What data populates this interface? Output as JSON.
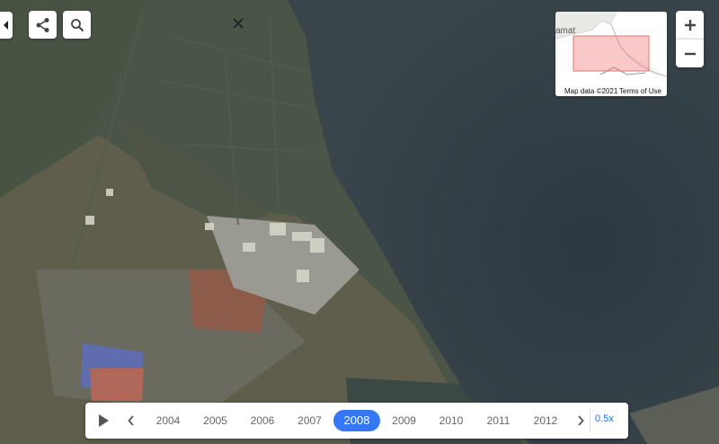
{
  "toolbar": {
    "collapse_icon": "chevron-left-icon",
    "share_icon": "share-icon",
    "search_icon": "search-icon",
    "close_icon": "close-icon"
  },
  "minimap": {
    "place_fragment": "amat",
    "attribution": "Map data ©2021",
    "terms_link": "Terms of Use"
  },
  "zoom": {
    "in_label": "+",
    "out_label": "−"
  },
  "timeline": {
    "play_icon": "play-icon",
    "prev_icon": "chevron-left-icon",
    "next_icon": "chevron-right-icon",
    "years": [
      "2004",
      "2005",
      "2006",
      "2007",
      "2008",
      "2009",
      "2010",
      "2011",
      "2012"
    ],
    "selected_year": "2008",
    "speed": "0.5x",
    "active_color": "#3478f6"
  }
}
